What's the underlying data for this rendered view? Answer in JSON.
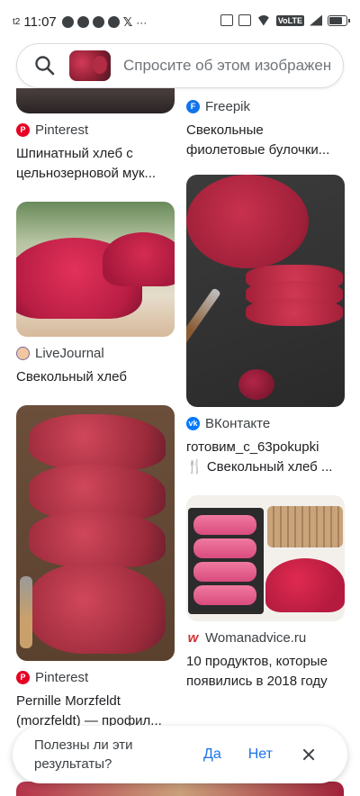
{
  "status_bar": {
    "carrier": "t2",
    "time": "11:07",
    "dots": "···"
  },
  "search": {
    "placeholder": "Спросите об этом изображении"
  },
  "results_left": [
    {
      "source": "Pinterest",
      "source_icon": "pinterest-icon",
      "title_line1": "Шпинатный хлеб с",
      "title_line2": "цельнозерновой мук..."
    },
    {
      "source": "LiveJournal",
      "source_icon": "livejournal-icon",
      "title_line1": "Свекольный хлеб"
    },
    {
      "source": "Pinterest",
      "source_icon": "pinterest-icon",
      "title_line1": "Pernille Morzfeldt",
      "title_line2": "(morzfeldt) — профил..."
    }
  ],
  "results_right": [
    {
      "source": "Freepik",
      "source_icon": "freepik-icon",
      "title_line1": "Свекольные",
      "title_line2": "фиолетовые булочки..."
    },
    {
      "source": "ВКонтакте",
      "source_icon": "vk-icon",
      "title_line1": "готовим_с_63pokupki",
      "title_line2": "🍴 Свекольный хлеб ..."
    },
    {
      "source": "Womanadvice.ru",
      "source_icon": "womanadvice-icon",
      "title_line1": "10 продуктов, которые",
      "title_line2": "появились в 2018 году"
    }
  ],
  "feedback": {
    "question": "Полезны ли эти результаты?",
    "yes_label": "Да",
    "no_label": "Нет"
  },
  "colors": {
    "accent": "#1a73e8",
    "pinterest": "#e60023",
    "vk": "#0077ff"
  }
}
